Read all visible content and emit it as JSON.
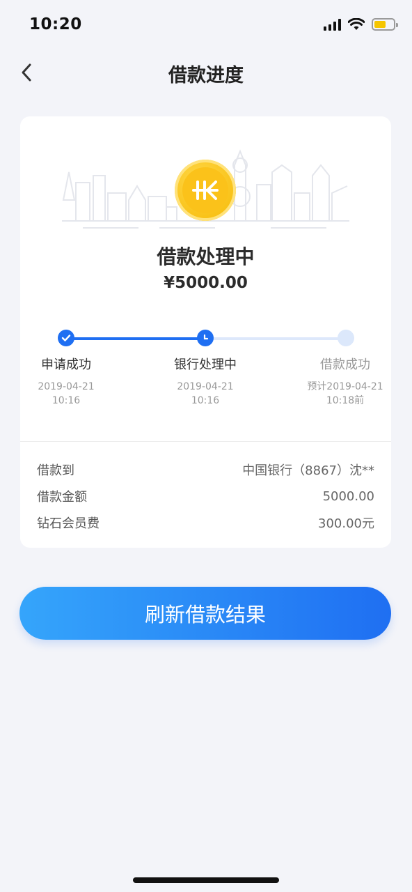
{
  "status_bar": {
    "time": "10:20",
    "battery_color": "#f5c500"
  },
  "nav": {
    "title": "借款进度",
    "back_icon": "chevron-left-icon"
  },
  "card": {
    "status_title": "借款处理中",
    "amount": "¥5000.00",
    "coin_icon": "coin-icon",
    "steps": [
      {
        "label": "申请成功",
        "date": "2019-04-21",
        "time": "10:16",
        "state": "done"
      },
      {
        "label": "银行处理中",
        "date": "2019-04-21",
        "time": "10:16",
        "state": "current"
      },
      {
        "label": "借款成功",
        "date": "预计2019-04-21",
        "time": "10:18前",
        "state": "pending"
      }
    ],
    "details": [
      {
        "key": "借款到",
        "value": "中国银行（8867）沈**"
      },
      {
        "key": "借款金额",
        "value": "5000.00"
      },
      {
        "key": "钻石会员费",
        "value": "300.00元"
      }
    ]
  },
  "refresh_button": {
    "label": "刷新借款结果"
  },
  "colors": {
    "accent": "#1f6ff2",
    "accent_light": "#35a5fb",
    "background": "#f3f4f9"
  }
}
